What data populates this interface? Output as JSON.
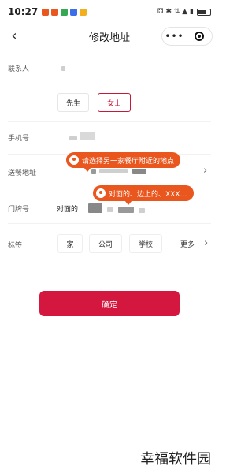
{
  "status_bar": {
    "time": "10:27",
    "app_icon_colors": [
      "#e9561e",
      "#e9561e",
      "#34a853",
      "#3b6ee8",
      "#f2b01e"
    ],
    "right_text": "⚃ ✱ ⇅ ▲ ▮"
  },
  "nav": {
    "back_icon": "chevron-left-icon",
    "title": "修改地址",
    "more_icon": "dots-icon",
    "close_icon": "target-icon"
  },
  "form": {
    "contact": {
      "label": "联系人"
    },
    "gender": {
      "options": [
        "先生",
        "女士"
      ],
      "selected": "女士"
    },
    "phone": {
      "label": "手机号"
    },
    "address": {
      "label": "送餐地址"
    },
    "door": {
      "label": "门牌号",
      "value_prefix": "对面的"
    },
    "tags": {
      "label": "标签",
      "options": [
        "家",
        "公司",
        "学校",
        "更多"
      ]
    }
  },
  "tooltips": {
    "address_hint": "请选择另一家餐厅附近的地点",
    "door_hint": "对面的、边上的、XXX…"
  },
  "confirm_button": "确定",
  "watermark": "幸福软件园",
  "colors": {
    "accent": "#d3173e",
    "tooltip": "#e9561e"
  }
}
